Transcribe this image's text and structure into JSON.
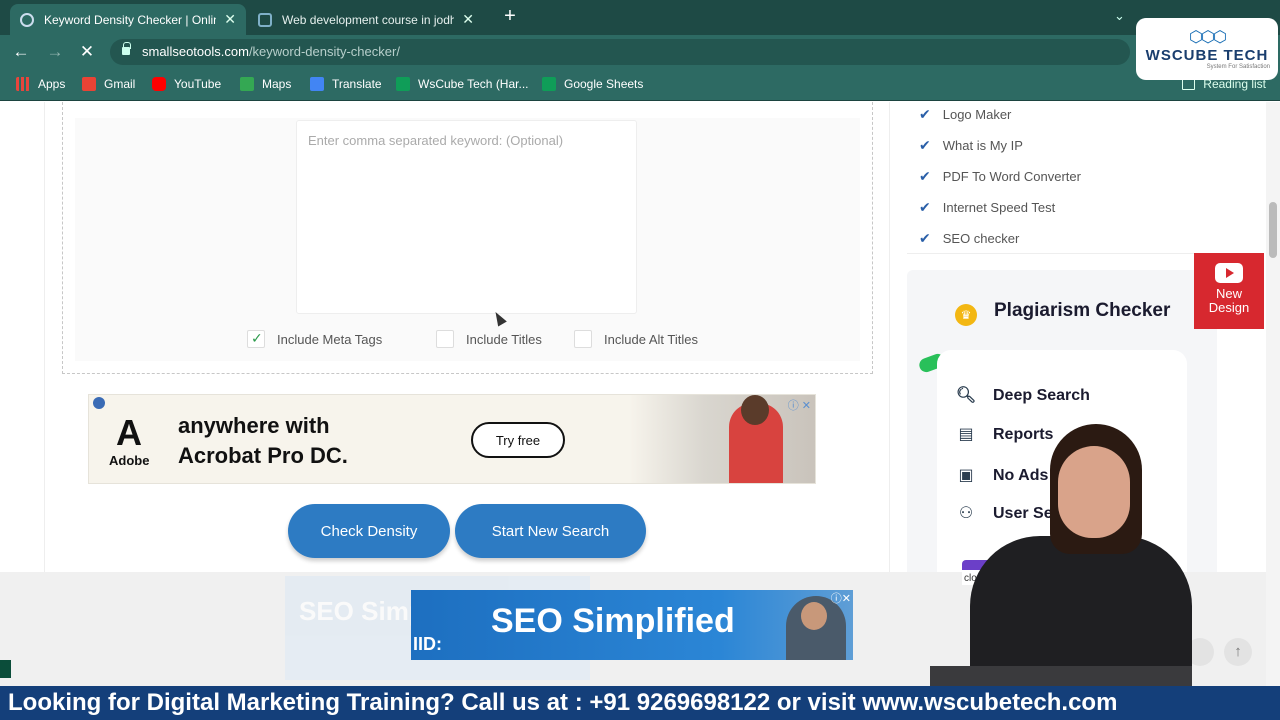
{
  "browser": {
    "tabs": [
      {
        "title": "Keyword Density Checker | Online",
        "active": true
      },
      {
        "title": "Web development course in jodhp",
        "active": false
      }
    ],
    "url_host": "smallseotools.com",
    "url_path": "/keyword-density-checker/",
    "bookmarks": [
      {
        "label": "Apps",
        "icon": "apps-grid-icon",
        "color": "#e8453c"
      },
      {
        "label": "Gmail",
        "icon": "gmail-icon",
        "color": "#ea4335"
      },
      {
        "label": "YouTube",
        "icon": "youtube-icon",
        "color": "#ff0000"
      },
      {
        "label": "Maps",
        "icon": "maps-icon",
        "color": "#34a853"
      },
      {
        "label": "Translate",
        "icon": "translate-icon",
        "color": "#4285f4"
      },
      {
        "label": "WsCube Tech (Har...",
        "icon": "sheets-icon",
        "color": "#0f9d58"
      },
      {
        "label": "Google Sheets",
        "icon": "sheets-icon",
        "color": "#0f9d58"
      }
    ],
    "reading_list": "Reading list"
  },
  "watermark": {
    "brand": "WSCUBE TECH",
    "tagline": "System For Satisfaction"
  },
  "form": {
    "keyword_placeholder": "Enter comma separated keyword: (Optional)",
    "options": [
      {
        "label": "Include Meta Tags",
        "checked": true
      },
      {
        "label": "Include Titles",
        "checked": false
      },
      {
        "label": "Include Alt Titles",
        "checked": false
      }
    ],
    "check_button": "Check Density",
    "new_search_button": "Start New Search"
  },
  "ad_adobe": {
    "brand": "Adobe",
    "line1": "anywhere with",
    "line2": "Acrobat Pro DC.",
    "cta": "Try free"
  },
  "sidebar": {
    "tools": [
      "Logo Maker",
      "What is My IP",
      "PDF To Word Converter",
      "Internet Speed Test",
      "SEO checker"
    ],
    "plagiarism_title": "Plagiarism Checker",
    "features": [
      "Deep Search",
      "Reports",
      "No Ads",
      "User Sea"
    ]
  },
  "yt_badge": {
    "line1": "New",
    "line2": "Design"
  },
  "seo_ad": {
    "faded_text": "SEO Simplif",
    "title": "SEO Simplified",
    "logo": "IID:"
  },
  "close_label": "close",
  "banner": "Looking for Digital Marketing Training? Call us at : +91 9269698122 or visit www.wscubetech.com"
}
